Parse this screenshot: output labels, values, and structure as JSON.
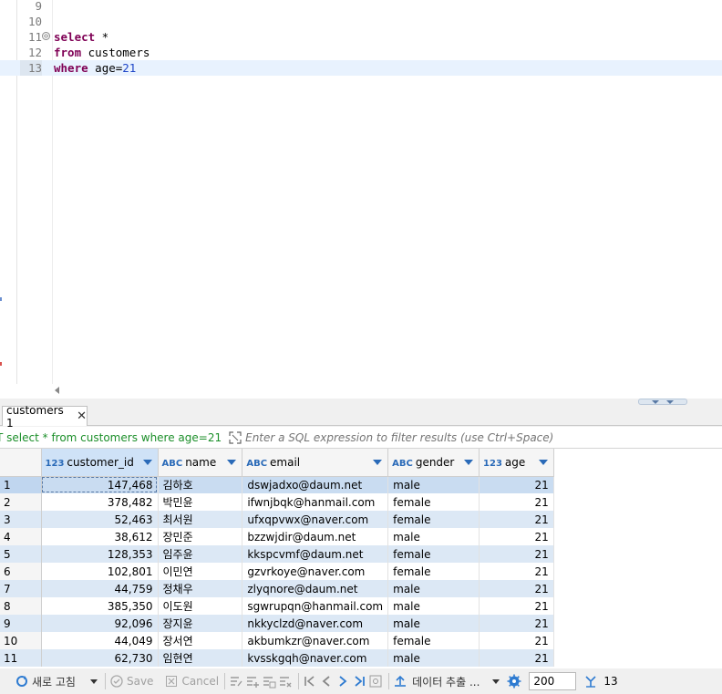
{
  "editor": {
    "lines": [
      {
        "num": "9",
        "code": ""
      },
      {
        "num": "10",
        "code": ""
      },
      {
        "num": "11",
        "kw": "select",
        "rest": " *",
        "fold": "⊖"
      },
      {
        "num": "12",
        "kw": "from",
        "rest": " customers"
      },
      {
        "num": "13",
        "kw": "where",
        "rest": " age=",
        "num_val": "21"
      }
    ]
  },
  "results": {
    "tab_label": "customers 1",
    "sql_prefix": "T",
    "sql_text": " select * from customers where age=21",
    "filter_placeholder": "Enter a SQL expression to filter results (use Ctrl+Space)",
    "columns": [
      {
        "type": "123",
        "name": "customer_id"
      },
      {
        "type": "ABC",
        "name": "name"
      },
      {
        "type": "ABC",
        "name": "email"
      },
      {
        "type": "ABC",
        "name": "gender"
      },
      {
        "type": "123",
        "name": "age"
      }
    ],
    "rows": [
      {
        "n": "1",
        "id": "147,468",
        "name": "김하호",
        "email": "dswjadxo@daum.net",
        "gender": "male",
        "age": "21"
      },
      {
        "n": "2",
        "id": "378,482",
        "name": "박민윤",
        "email": "ifwnjbqk@hanmail.com",
        "gender": "female",
        "age": "21"
      },
      {
        "n": "3",
        "id": "52,463",
        "name": "최서원",
        "email": "ufxqpvwx@naver.com",
        "gender": "female",
        "age": "21"
      },
      {
        "n": "4",
        "id": "38,612",
        "name": "장민준",
        "email": "bzzwjdir@daum.net",
        "gender": "male",
        "age": "21"
      },
      {
        "n": "5",
        "id": "128,353",
        "name": "임주윤",
        "email": "kkspcvmf@daum.net",
        "gender": "female",
        "age": "21"
      },
      {
        "n": "6",
        "id": "102,801",
        "name": "이민연",
        "email": "gzvrkoye@naver.com",
        "gender": "female",
        "age": "21"
      },
      {
        "n": "7",
        "id": "44,759",
        "name": "정채우",
        "email": "zlyqnore@daum.net",
        "gender": "male",
        "age": "21"
      },
      {
        "n": "8",
        "id": "385,350",
        "name": "이도원",
        "email": "sgwrupqn@hanmail.com",
        "gender": "male",
        "age": "21"
      },
      {
        "n": "9",
        "id": "92,096",
        "name": "장지윤",
        "email": "nkkyclzd@naver.com",
        "gender": "male",
        "age": "21"
      },
      {
        "n": "10",
        "id": "44,049",
        "name": "장서연",
        "email": "akbumkzr@naver.com",
        "gender": "female",
        "age": "21"
      },
      {
        "n": "11",
        "id": "62,730",
        "name": "임현연",
        "email": "kvsskgqh@naver.com",
        "gender": "male",
        "age": "21"
      }
    ]
  },
  "toolbar": {
    "refresh_label": "새로 고침",
    "save_label": "Save",
    "cancel_label": "Cancel",
    "export_label": "데이터 추출 ...",
    "fetch_size": "200",
    "row_count": "13"
  },
  "colors": {
    "keyword": "#7f0055",
    "number": "#1f46c8",
    "sql_green": "#1c8f2a",
    "row_alt": "#dce8f5",
    "accent": "#2a6ab8"
  }
}
